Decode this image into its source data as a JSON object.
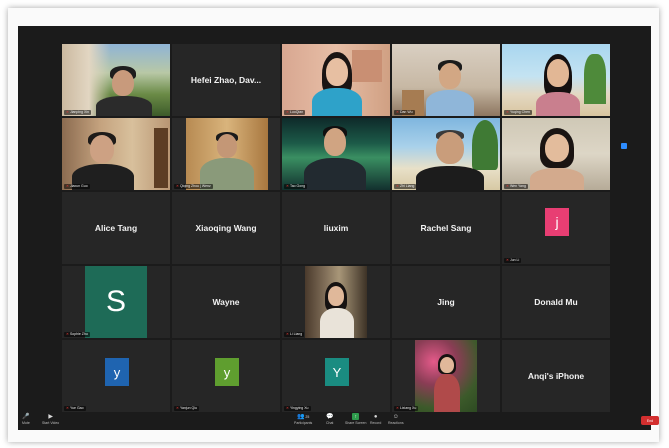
{
  "meeting": {
    "tiles": [
      {
        "id": "t01",
        "type": "video",
        "label": "Jianping Xin"
      },
      {
        "id": "t02",
        "type": "name",
        "name": "Hefei Zhao, Dav...",
        "label": ""
      },
      {
        "id": "t03",
        "type": "video",
        "label": "LuoQian"
      },
      {
        "id": "t04",
        "type": "video",
        "label": "Dan Wu"
      },
      {
        "id": "t05",
        "type": "video",
        "label": "Yuqing Chen"
      },
      {
        "id": "t06",
        "type": "video",
        "label": "Jiaxun Guo"
      },
      {
        "id": "t07",
        "type": "video",
        "label": "Qiqing Zhou | Wenz"
      },
      {
        "id": "t08",
        "type": "video",
        "label": "Tao Gong"
      },
      {
        "id": "t09",
        "type": "video",
        "label": "Zhi Liang"
      },
      {
        "id": "t10",
        "type": "video",
        "label": "Wen Yang"
      },
      {
        "id": "t11",
        "type": "name",
        "name": "Alice Tang",
        "label": ""
      },
      {
        "id": "t12",
        "type": "name",
        "name": "Xiaoqing Wang",
        "label": ""
      },
      {
        "id": "t13",
        "type": "name",
        "name": "liuxim",
        "label": ""
      },
      {
        "id": "t14",
        "type": "name",
        "name": "Rachel Sang",
        "label": ""
      },
      {
        "id": "t15",
        "type": "avatar",
        "letter": "j",
        "label": "Jun Li"
      },
      {
        "id": "t16",
        "type": "avatar",
        "letter": "S",
        "label": "Sophie Zhu"
      },
      {
        "id": "t17",
        "type": "name",
        "name": "Wayne",
        "label": ""
      },
      {
        "id": "t18",
        "type": "video",
        "label": "Li Liang"
      },
      {
        "id": "t19",
        "type": "name",
        "name": "Jing",
        "label": ""
      },
      {
        "id": "t20",
        "type": "name",
        "name": "Donald Mu",
        "label": ""
      },
      {
        "id": "t21",
        "type": "avatar",
        "letter": "y",
        "label": "Yue Gao"
      },
      {
        "id": "t22",
        "type": "avatar",
        "letter": "y",
        "label": "Yanjun Qiu"
      },
      {
        "id": "t23",
        "type": "avatar",
        "letter": "Y",
        "label": "Yingying Xu"
      },
      {
        "id": "t24",
        "type": "video",
        "label": "Lixiang Xu"
      },
      {
        "id": "t25",
        "type": "name",
        "name": "Anqi's iPhone",
        "label": ""
      }
    ]
  },
  "toolbar": {
    "items": [
      {
        "label": "Mute",
        "icon": "microphone-icon"
      },
      {
        "label": "Start Video",
        "icon": "video-camera-icon"
      },
      {
        "label": "Participants",
        "icon": "participants-icon",
        "count": "25"
      },
      {
        "label": "Chat",
        "icon": "chat-icon"
      },
      {
        "label": "Share Screen",
        "icon": "share-screen-icon"
      },
      {
        "label": "Record",
        "icon": "record-icon"
      },
      {
        "label": "Reactions",
        "icon": "reactions-icon"
      }
    ],
    "end_label": "End"
  },
  "colors": {
    "avatar_j": "#e83e73",
    "avatar_S": "#1e6b57",
    "avatar_y1": "#1f64b0",
    "avatar_y2": "#5f9e2f",
    "avatar_Y3": "#1a8c81",
    "selected_outline": "#d6f24a"
  }
}
